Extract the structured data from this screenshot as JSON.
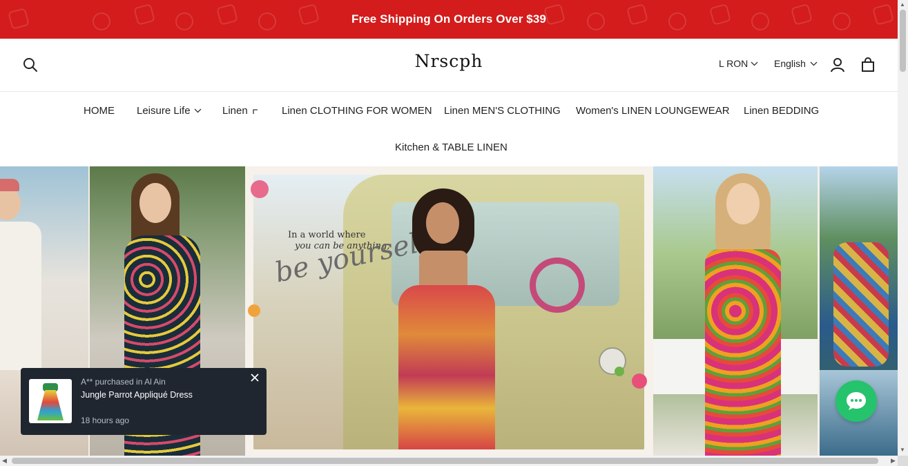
{
  "announcement": {
    "text": "Free Shipping On Orders Over $39",
    "bg_color": "#d41c1c"
  },
  "header": {
    "logo": "Nrscph",
    "currency": "L RON",
    "language": "English",
    "icons": [
      "search-icon",
      "user-icon",
      "shopping-bag-icon"
    ]
  },
  "nav": {
    "items": [
      {
        "label": "HOME",
        "has_dropdown": false
      },
      {
        "label": "Leisure Life",
        "has_dropdown": true
      },
      {
        "label": "Linen",
        "has_dropdown": true
      },
      {
        "label": "Linen CLOTHING FOR WOMEN",
        "has_dropdown": false
      },
      {
        "label": "Linen MEN'S CLOTHING",
        "has_dropdown": false
      },
      {
        "label": "Women's LINEN LOUNGEWEAR",
        "has_dropdown": false
      },
      {
        "label": "Linen BEDDING",
        "has_dropdown": false
      },
      {
        "label": "Kitchen & TABLE LINEN",
        "has_dropdown": false
      }
    ]
  },
  "hero": {
    "tagline_line1": "In a world where",
    "tagline_line2": "you can be anything,",
    "tagline_script": "be yourself!"
  },
  "notification": {
    "who": "A** purchased in Al Ain",
    "product": "Jungle Parrot Appliqué Dress",
    "time": "18 hours ago",
    "close_icon": "close-icon"
  },
  "chat": {
    "icon": "chat-bubble-icon",
    "color": "#25c36b"
  }
}
